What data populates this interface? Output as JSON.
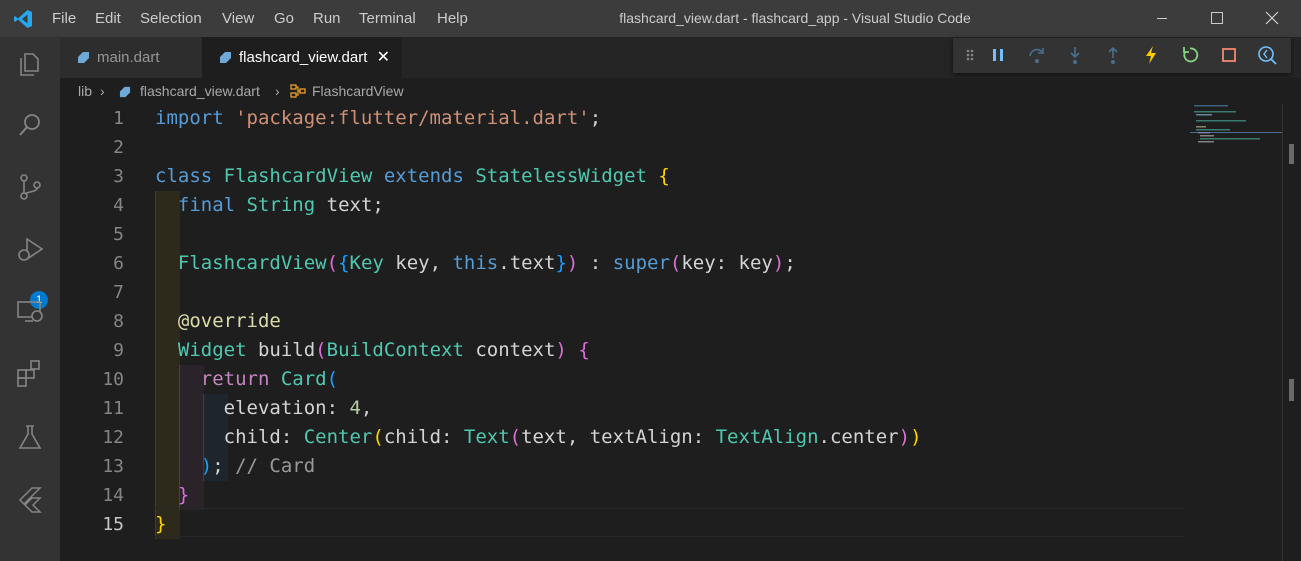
{
  "titlebar": {
    "menu": [
      "File",
      "Edit",
      "Selection",
      "View",
      "Go",
      "Run",
      "Terminal",
      "Help"
    ],
    "window_title": "flashcard_view.dart - flashcard_app - Visual Studio Code"
  },
  "activity_bar": {
    "icons": [
      "explorer-icon",
      "search-icon",
      "source-control-icon",
      "run-debug-icon",
      "remote-explorer-icon",
      "extensions-icon",
      "testing-icon",
      "flutter-icon"
    ],
    "debug_badge": "1"
  },
  "tabs": [
    {
      "label": "main.dart",
      "active": false
    },
    {
      "label": "flashcard_view.dart",
      "active": true
    }
  ],
  "tab_close": "✕",
  "debug_toolbar": [
    "drag-handle-icon",
    "pause-icon",
    "step-over-icon",
    "step-into-icon",
    "step-out-icon",
    "hot-reload-icon",
    "hot-restart-icon",
    "stop-icon",
    "devtools-icon"
  ],
  "breadcrumb": {
    "folder": "lib",
    "file": "flashcard_view.dart",
    "symbol": "FlashcardView"
  },
  "editor": {
    "line_numbers": [
      "1",
      "2",
      "3",
      "4",
      "5",
      "6",
      "7",
      "8",
      "9",
      "10",
      "11",
      "12",
      "13",
      "14",
      "15"
    ],
    "active_line": "15",
    "lines": [
      [
        {
          "t": "import",
          "c": "kw"
        },
        {
          "t": " ",
          "c": "pl"
        },
        {
          "t": "'package:flutter/material.dart'",
          "c": "st"
        },
        {
          "t": ";",
          "c": "pl"
        }
      ],
      [],
      [
        {
          "t": "class",
          "c": "kw"
        },
        {
          "t": " ",
          "c": "pl"
        },
        {
          "t": "FlashcardView",
          "c": "ty"
        },
        {
          "t": " ",
          "c": "pl"
        },
        {
          "t": "extends",
          "c": "kw"
        },
        {
          "t": " ",
          "c": "pl"
        },
        {
          "t": "StatelessWidget",
          "c": "ty"
        },
        {
          "t": " ",
          "c": "pl"
        },
        {
          "t": "{",
          "c": "b1"
        }
      ],
      [
        {
          "t": "  ",
          "c": "pl"
        },
        {
          "t": "final",
          "c": "kw"
        },
        {
          "t": " ",
          "c": "pl"
        },
        {
          "t": "String",
          "c": "ty"
        },
        {
          "t": " text;",
          "c": "pl"
        }
      ],
      [],
      [
        {
          "t": "  ",
          "c": "pl"
        },
        {
          "t": "FlashcardView",
          "c": "ty"
        },
        {
          "t": "(",
          "c": "b2"
        },
        {
          "t": "{",
          "c": "b3"
        },
        {
          "t": "Key",
          "c": "ty"
        },
        {
          "t": " key, ",
          "c": "pl"
        },
        {
          "t": "this",
          "c": "kw"
        },
        {
          "t": ".text",
          "c": "pl"
        },
        {
          "t": "}",
          "c": "b3"
        },
        {
          "t": ")",
          "c": "b2"
        },
        {
          "t": " : ",
          "c": "pl"
        },
        {
          "t": "super",
          "c": "kw"
        },
        {
          "t": "(",
          "c": "b2"
        },
        {
          "t": "key: key",
          "c": "pl"
        },
        {
          "t": ")",
          "c": "b2"
        },
        {
          "t": ";",
          "c": "pl"
        }
      ],
      [],
      [
        {
          "t": "  ",
          "c": "pl"
        },
        {
          "t": "@override",
          "c": "fn"
        }
      ],
      [
        {
          "t": "  ",
          "c": "pl"
        },
        {
          "t": "Widget",
          "c": "ty"
        },
        {
          "t": " build",
          "c": "pl"
        },
        {
          "t": "(",
          "c": "b2"
        },
        {
          "t": "BuildContext",
          "c": "ty"
        },
        {
          "t": " context",
          "c": "pl"
        },
        {
          "t": ")",
          "c": "b2"
        },
        {
          "t": " ",
          "c": "pl"
        },
        {
          "t": "{",
          "c": "b2"
        }
      ],
      [
        {
          "t": "    ",
          "c": "pl"
        },
        {
          "t": "return",
          "c": "ctrl"
        },
        {
          "t": " ",
          "c": "pl"
        },
        {
          "t": "Card",
          "c": "ty"
        },
        {
          "t": "(",
          "c": "b3"
        }
      ],
      [
        {
          "t": "      elevation: ",
          "c": "pl"
        },
        {
          "t": "4",
          "c": "nm"
        },
        {
          "t": ",",
          "c": "pl"
        }
      ],
      [
        {
          "t": "      child: ",
          "c": "pl"
        },
        {
          "t": "Center",
          "c": "ty"
        },
        {
          "t": "(",
          "c": "b1"
        },
        {
          "t": "child: ",
          "c": "pl"
        },
        {
          "t": "Text",
          "c": "ty"
        },
        {
          "t": "(",
          "c": "b2"
        },
        {
          "t": "text, textAlign: ",
          "c": "pl"
        },
        {
          "t": "TextAlign",
          "c": "ty"
        },
        {
          "t": ".center",
          "c": "pl"
        },
        {
          "t": ")",
          "c": "b2"
        },
        {
          "t": ")",
          "c": "b1"
        }
      ],
      [
        {
          "t": "    ",
          "c": "pl"
        },
        {
          "t": ")",
          "c": "b3"
        },
        {
          "t": "; ",
          "c": "pl"
        },
        {
          "t": "// Card",
          "c": "cmt"
        }
      ],
      [
        {
          "t": "  ",
          "c": "pl"
        },
        {
          "t": "}",
          "c": "b2"
        }
      ],
      [
        {
          "t": "}",
          "c": "b1"
        }
      ]
    ]
  }
}
